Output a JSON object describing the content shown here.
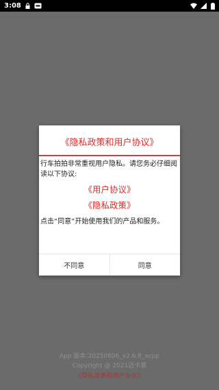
{
  "status_bar": {
    "time": "3:08",
    "icons": [
      "lock-icon",
      "notification-icon",
      "wifi-icon",
      "cell-signal-icon",
      "battery-icon"
    ]
  },
  "background": {
    "version": "App 版本:20250606_v2.6.8_xcpp",
    "copyright": "Copyright @ 2021迈卡盾",
    "privacy_link": "《隐私政策和用户协议》"
  },
  "dialog": {
    "title": "《隐私政策和用户协议》",
    "intro": "行车拍拍非常重视用户隐私。请您务必仔细阅读以下协议:",
    "user_agreement_link": "《用户协议》",
    "privacy_policy_link": "《隐私政策》",
    "outro": "点击“同意”开始使用我们的产品和服务。",
    "disagree_label": "不同意",
    "agree_label": "同意"
  },
  "colors": {
    "accent": "#e02a2a",
    "overlay": "#6b6b6b",
    "status_bar": "#000000"
  }
}
